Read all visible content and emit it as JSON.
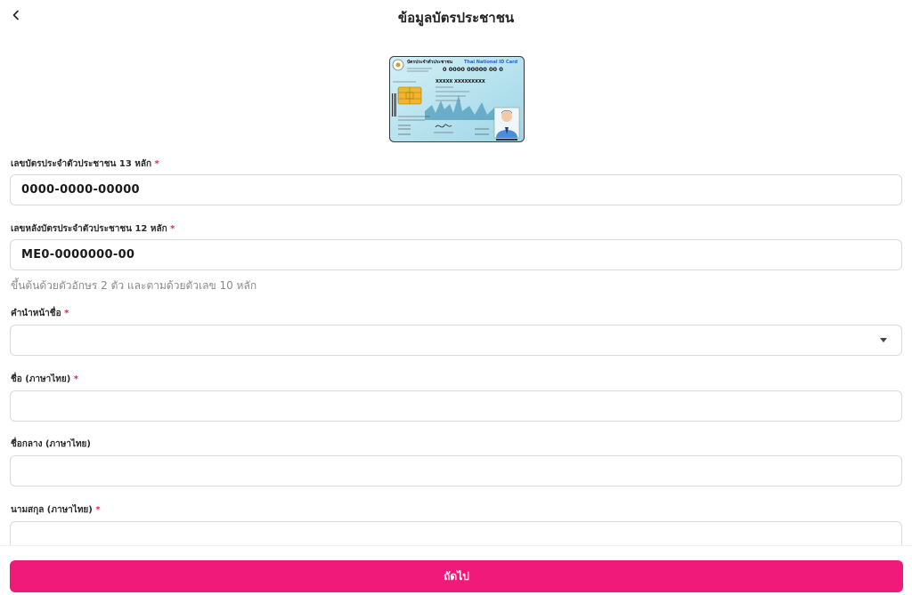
{
  "header": {
    "title": "ข้อมูลบัตรประชาชน",
    "back_icon": "chevron-left-icon"
  },
  "card_image": {
    "title_th": "บัตรประจำตัวประชาชน",
    "title_en": "Thai National ID Card",
    "id_number": "0 0000 00000 00 0",
    "name": "XXXXX XXXXXXXXX",
    "colors": {
      "card_bg": "#aee0ec",
      "card_border": "#3a3a3a",
      "title_en_color": "#1e64c8"
    }
  },
  "form": {
    "id_number": {
      "label": "เลขบัตรประจำตัวประชาชน 13 หลัก",
      "required_mark": "*",
      "value": "0000-0000-00000"
    },
    "laser_code": {
      "label": "เลขหลังบัตรประจำตัวประชาชน 12 หลัก",
      "required_mark": "*",
      "value": "ME0-0000000-00",
      "hint": "ขึ้นต้นด้วยตัวอักษร 2 ตัว และตามด้วยตัวเลข 10 หลัก"
    },
    "prefix": {
      "label": "คำนำหน้าชื่อ",
      "required_mark": "*",
      "value": ""
    },
    "first_name": {
      "label": "ชื่อ (ภาษาไทย)",
      "required_mark": "*",
      "value": ""
    },
    "middle_name": {
      "label": "ชื่อกลาง (ภาษาไทย)",
      "value": ""
    },
    "last_name": {
      "label": "นามสกุล (ภาษาไทย)",
      "required_mark": "*",
      "value": ""
    }
  },
  "footer": {
    "next_label": "ถัดไป"
  },
  "colors": {
    "accent": "#ef1a7a",
    "required": "#e3285a",
    "border": "#d9d9d9",
    "hint": "#8a8a8a"
  }
}
